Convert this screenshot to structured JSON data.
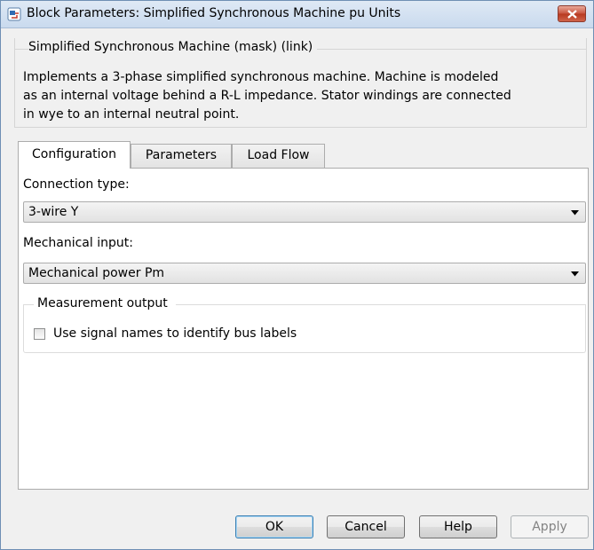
{
  "window": {
    "title": "Block Parameters: Simplified Synchronous Machine pu Units",
    "close_icon": "close-x-icon",
    "app_icon": "simulink-block-icon"
  },
  "mask": {
    "header": "Simplified Synchronous Machine (mask) (link)",
    "description": "Implements a 3-phase simplified synchronous machine. Machine is modeled\nas an internal voltage behind a R-L impedance. Stator windings are connected\nin wye to an internal neutral point."
  },
  "tabs": [
    {
      "label": "Configuration",
      "active": true
    },
    {
      "label": "Parameters",
      "active": false
    },
    {
      "label": "Load Flow",
      "active": false
    }
  ],
  "configuration": {
    "connection_type_label": "Connection type:",
    "connection_type_value": "3-wire Y",
    "mechanical_input_label": "Mechanical input:",
    "mechanical_input_value": "Mechanical power Pm",
    "measurement_output_header": "Measurement output",
    "use_signal_names_label": "Use signal names to identify bus labels",
    "use_signal_names_checked": false
  },
  "buttons": {
    "ok": "OK",
    "cancel": "Cancel",
    "help": "Help",
    "apply": "Apply"
  },
  "colors": {
    "close_button": "#c7523c",
    "default_button_border": "#3c7fb1"
  }
}
